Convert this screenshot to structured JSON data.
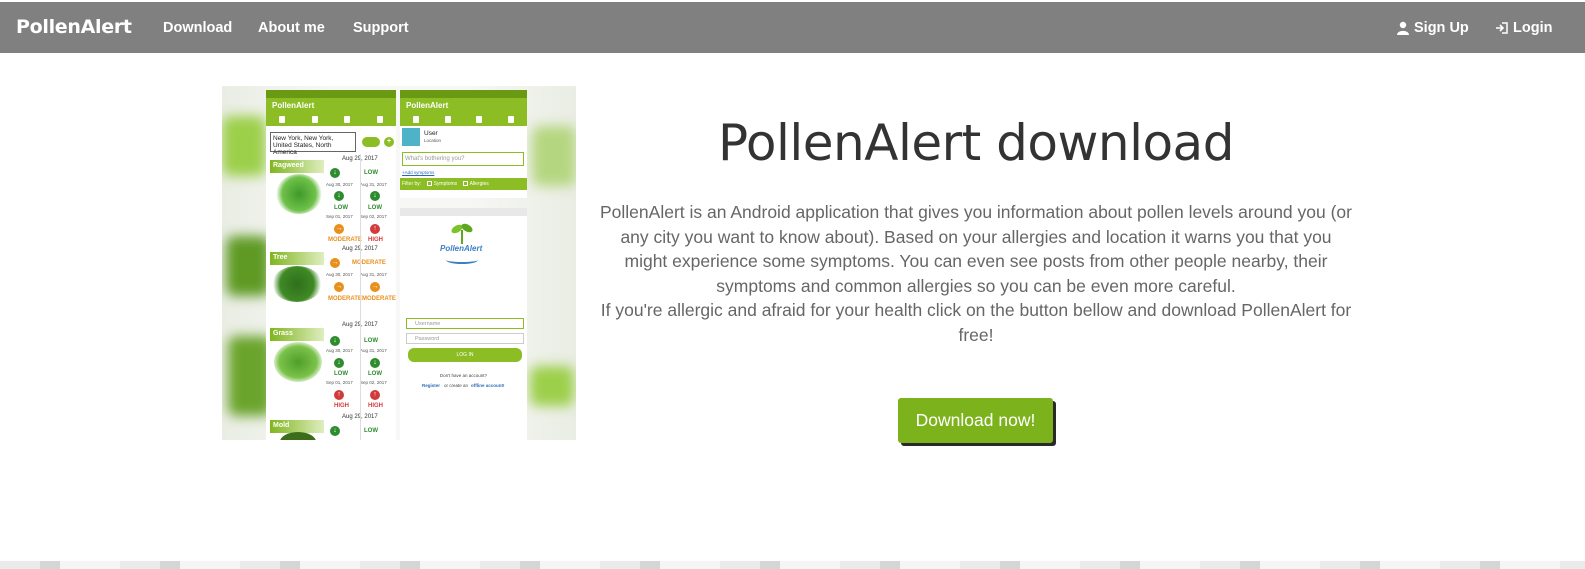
{
  "navbar": {
    "brand": "PollenAlert",
    "links": [
      "Download",
      "About me",
      "Support"
    ],
    "signup": "Sign Up",
    "login": "Login"
  },
  "hero": {
    "title": "PollenAlert download",
    "paragraph1": "PollenAlert is an Android application that gives you information about pollen levels around you (or any city you want to know about). Based on your allergies and location it warns you that you might experience some symptoms. You can even see posts from other people nearby, their symptoms and common allergies so you can be even more careful.",
    "paragraph2": "If you're allergic and afraid for your health click on the button bellow and download PollenAlert for free!",
    "button": "Download now!"
  },
  "screenshot": {
    "app_title": "PollenAlert",
    "location": "New York, New York, United States, North America",
    "plants": [
      "Ragweed",
      "Tree",
      "Grass",
      "Mold"
    ],
    "date_main": "Aug 29, 2017",
    "dates": [
      "Aug 30, 2017",
      "Aug 31, 2017",
      "Sep 01, 2017",
      "Sep 02, 2017"
    ],
    "levels": {
      "low": "LOW",
      "moderate": "MODERATE",
      "high": "HIGH"
    },
    "user": "User",
    "user_sub": "Location",
    "bother_placeholder": "What's bothering you?",
    "add_symptoms": "+Add symptoms",
    "filter_by": "Filter by:",
    "filter_symptoms": "Symptoms",
    "filter_allergies": "Allergies",
    "logo_text": "PollenAlert",
    "username": "Username",
    "password": "Password",
    "login_btn": "LOG IN",
    "no_account": "Don't have an account?",
    "register": "Register",
    "or_text": "or create an",
    "offline": "offline account!"
  },
  "colors": {
    "navbar": "#808080",
    "accent": "#7cb21c",
    "low": "#2e8b2e",
    "moderate": "#e8901c",
    "high": "#d23b3b"
  }
}
